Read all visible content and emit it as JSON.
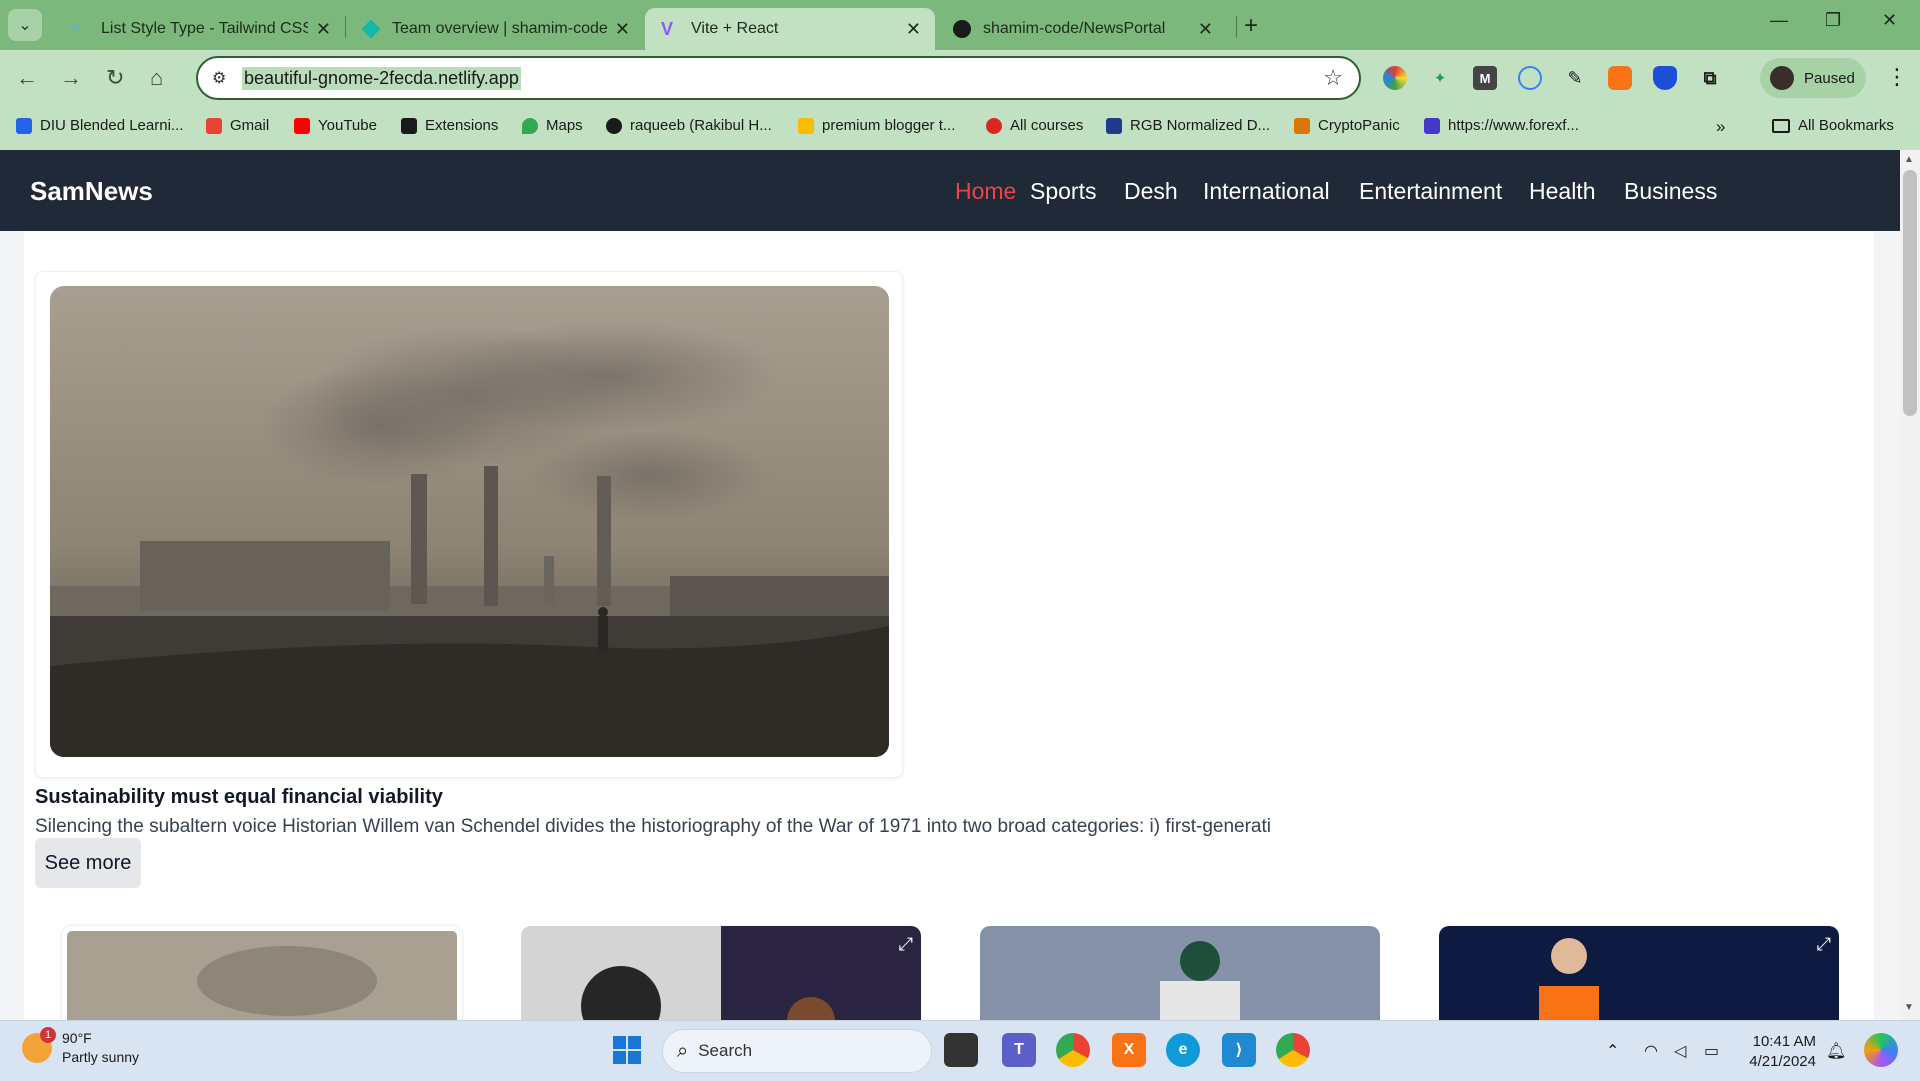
{
  "browser": {
    "tabs": [
      {
        "title": "List Style Type - Tailwind CSS",
        "active": false
      },
      {
        "title": "Team overview | shamim-code",
        "active": false
      },
      {
        "title": "Vite + React",
        "active": true
      },
      {
        "title": "shamim-code/NewsPortal",
        "active": false
      }
    ],
    "url": "beautiful-gnome-2fecda.netlify.app",
    "profile_label": "Paused",
    "bookmarks": [
      "DIU Blended Learni...",
      "Gmail",
      "YouTube",
      "Extensions",
      "Maps",
      "raqueeb (Rakibul H...",
      "premium blogger t...",
      "All courses",
      "RGB Normalized D...",
      "CryptoPanic",
      "https://www.forexf..."
    ],
    "all_bookmarks_label": "All Bookmarks"
  },
  "site": {
    "brand": "SamNews",
    "nav": [
      "Home",
      "Sports",
      "Desh",
      "International",
      "Entertainment",
      "Health",
      "Business"
    ],
    "active_nav": "Home",
    "hero": {
      "title": "Sustainability must equal financial viability",
      "description": "Silencing the subaltern voice Historian Willem van Schendel divides the historiography of the War of 1971 into two broad categories: i) first-generati",
      "button": "See more"
    }
  },
  "taskbar": {
    "weather_temp": "90°F",
    "weather_desc": "Partly sunny",
    "weather_badge": "1",
    "search_placeholder": "Search",
    "time": "10:41 AM",
    "date": "4/21/2024"
  },
  "colors": {
    "chrome_tabbar": "#7cb87c",
    "chrome_toolbar": "#c2e0c2",
    "navbar_bg": "#1f2937",
    "nav_active": "#ef4444"
  }
}
